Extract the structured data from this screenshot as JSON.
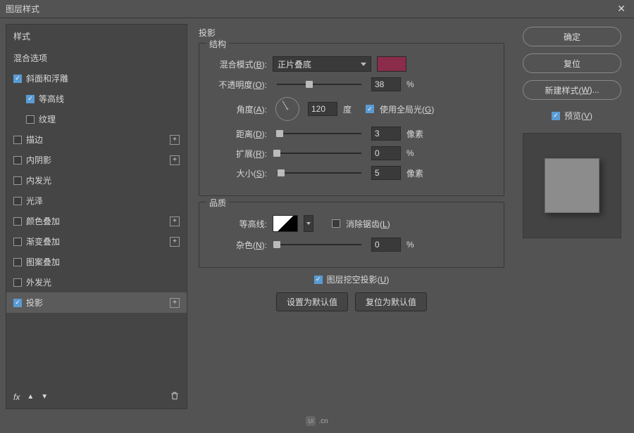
{
  "window": {
    "title": "图层样式"
  },
  "sidebar": {
    "header": "样式",
    "blend_options": "混合选项",
    "items": [
      {
        "label": "斜面和浮雕",
        "checked": true,
        "add": false,
        "indent": 0
      },
      {
        "label": "等高线",
        "checked": true,
        "add": false,
        "indent": 1
      },
      {
        "label": "纹理",
        "checked": false,
        "add": false,
        "indent": 1
      },
      {
        "label": "描边",
        "checked": false,
        "add": true,
        "indent": 0
      },
      {
        "label": "内阴影",
        "checked": false,
        "add": true,
        "indent": 0
      },
      {
        "label": "内发光",
        "checked": false,
        "add": false,
        "indent": 0
      },
      {
        "label": "光泽",
        "checked": false,
        "add": false,
        "indent": 0
      },
      {
        "label": "颜色叠加",
        "checked": false,
        "add": true,
        "indent": 0
      },
      {
        "label": "渐变叠加",
        "checked": false,
        "add": true,
        "indent": 0
      },
      {
        "label": "图案叠加",
        "checked": false,
        "add": false,
        "indent": 0
      },
      {
        "label": "外发光",
        "checked": false,
        "add": false,
        "indent": 0
      },
      {
        "label": "投影",
        "checked": true,
        "add": true,
        "indent": 0,
        "selected": true
      }
    ],
    "fx": "fx"
  },
  "main": {
    "title": "投影",
    "structure": {
      "legend": "结构",
      "blend_mode_label": "混合模式(B):",
      "blend_mode_value": "正片叠底",
      "color": "#8a2c4a",
      "opacity_label": "不透明度(O):",
      "opacity_value": "38",
      "opacity_unit": "%",
      "angle_label": "角度(A):",
      "angle_value": "120",
      "angle_unit": "度",
      "global_light_label": "使用全局光(G)",
      "distance_label": "距离(D):",
      "distance_value": "3",
      "distance_unit": "像素",
      "spread_label": "扩展(R):",
      "spread_value": "0",
      "spread_unit": "%",
      "size_label": "大小(S):",
      "size_value": "5",
      "size_unit": "像素"
    },
    "quality": {
      "legend": "品质",
      "contour_label": "等高线:",
      "antialias_label": "消除锯齿(L)",
      "noise_label": "杂色(N):",
      "noise_value": "0",
      "noise_unit": "%"
    },
    "knockout_label": "图层挖空投影(U)",
    "make_default": "设置为默认值",
    "reset_default": "复位为默认值"
  },
  "right": {
    "ok": "确定",
    "reset": "复位",
    "new_style": "新建样式(W)...",
    "preview": "预览(V)"
  },
  "footer": {
    "brand": "UI",
    "suffix": ".cn"
  }
}
